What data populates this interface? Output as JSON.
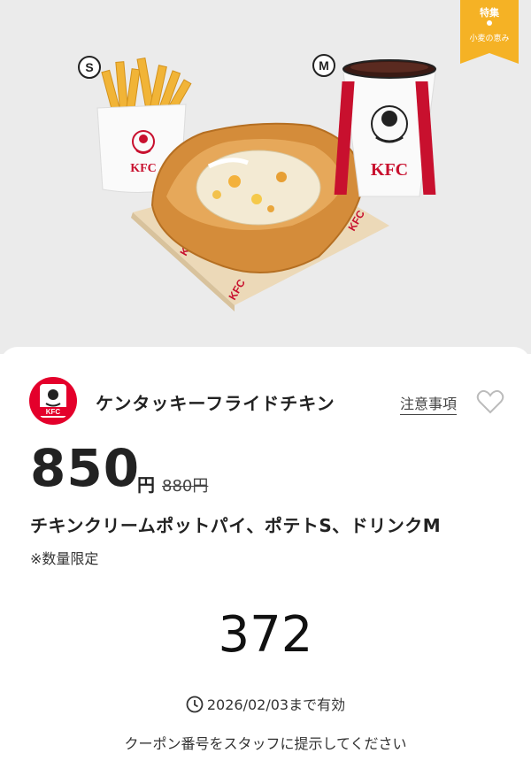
{
  "hero": {
    "size_s": "S",
    "size_m": "M",
    "brand_mark": "KFC"
  },
  "ribbon": {
    "line1": "特集",
    "line2": "小麦の恵み",
    "color": "#f5b225"
  },
  "store": {
    "name": "ケンタッキーフライドチキン",
    "logo_text": "KFC",
    "brand_color": "#e4002b"
  },
  "notes_link": "注意事項",
  "favorite_icon": "heart-outline-icon",
  "price": {
    "value": "850",
    "unit": "円",
    "original": "880円"
  },
  "product_name": "チキンクリームポットパイ、ポテトS、ドリンクM",
  "limited_note": "※数量限定",
  "coupon_code": "372",
  "validity": "2026/02/03まで有効",
  "instruction": "クーポン番号をスタッフに提示してください"
}
